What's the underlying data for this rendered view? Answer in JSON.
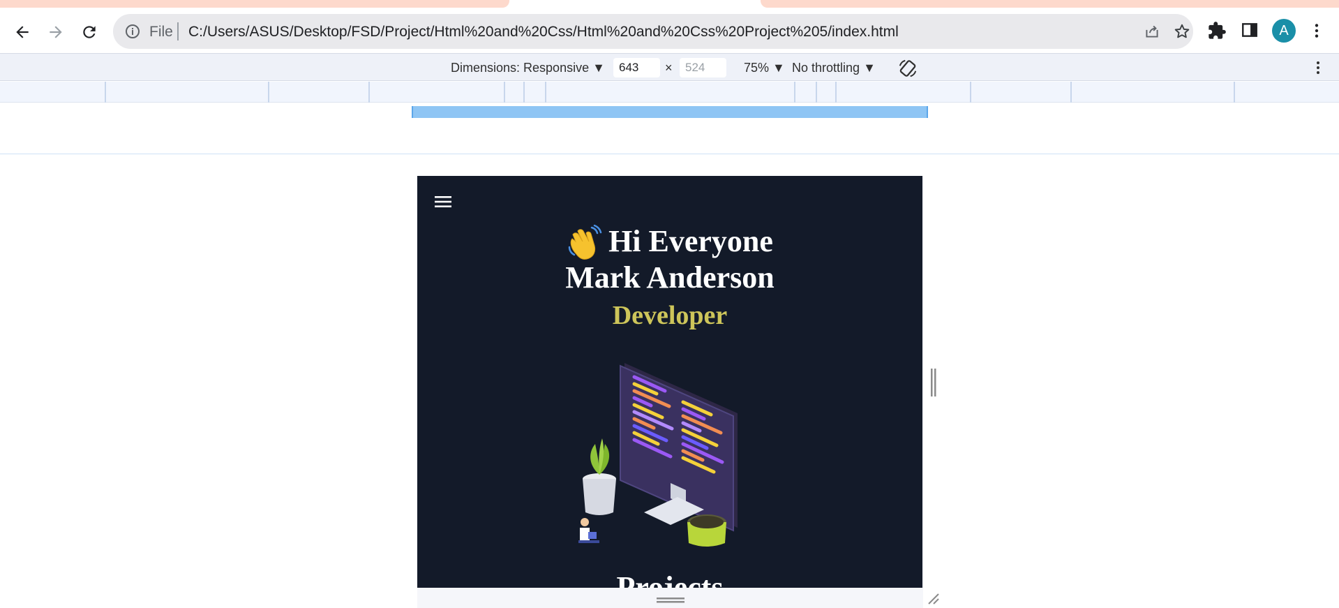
{
  "browser": {
    "omnibox": {
      "scheme_label": "File",
      "url": "C:/Users/ASUS/Desktop/FSD/Project/Html%20and%20Css/Html%20and%20Css%20Project%205/index.html"
    },
    "profile_initial": "A",
    "accent_color": "#1a8fa8"
  },
  "devtools": {
    "dimensions_label": "Dimensions: Responsive",
    "width_value": "643",
    "height_placeholder": "524",
    "times": "×",
    "zoom": "75%",
    "throttling": "No throttling"
  },
  "site": {
    "greeting": "Hi Everyone",
    "name": "Mark Anderson",
    "role": "Developer",
    "next_section_title": "Projects",
    "background_color": "#131a29",
    "role_color": "#cdc55a"
  },
  "icons": [
    "back-icon",
    "forward-icon",
    "reload-icon",
    "info-icon",
    "share-icon",
    "star-icon",
    "extensions-icon",
    "side-panel-icon",
    "menu-dots-icon",
    "rotate-icon",
    "hamburger-icon",
    "wave-emoji-icon"
  ]
}
